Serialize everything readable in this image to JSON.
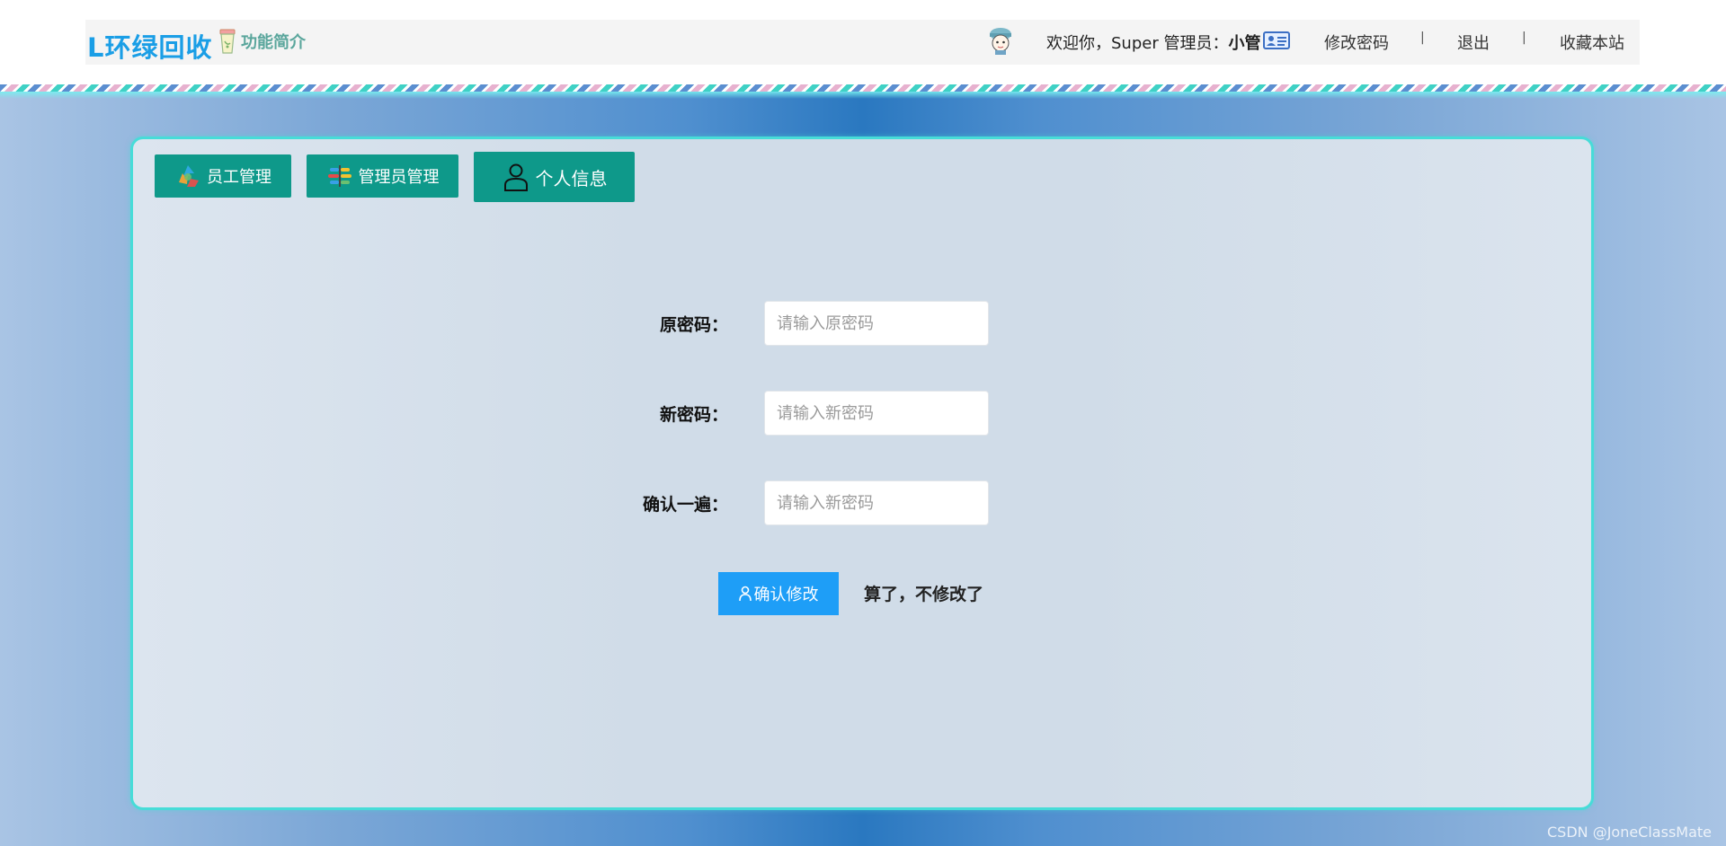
{
  "header": {
    "brand": "L环绿回收",
    "intro_link": "功能简介",
    "welcome_prefix": "欢迎你，Super 管理员：",
    "user_name": "小管",
    "change_password": "修改密码",
    "separator": "|",
    "logout": "退出",
    "bookmark": "收藏本站"
  },
  "tabs": [
    {
      "label": "员工管理",
      "icon": "recycle-icon"
    },
    {
      "label": "管理员管理",
      "icon": "sort-icon"
    },
    {
      "label": "个人信息",
      "icon": "user-icon"
    }
  ],
  "form": {
    "old_password": {
      "label": "原密码：",
      "placeholder": "请输入原密码",
      "value": ""
    },
    "new_password": {
      "label": "新密码：",
      "placeholder": "请输入新密码",
      "value": ""
    },
    "confirm_password": {
      "label": "确认一遍：",
      "placeholder": "请输入新密码",
      "value": ""
    },
    "confirm_button": "确认修改",
    "cancel_text": "算了，不修改了"
  },
  "watermark": "CSDN @JoneClassMate",
  "colors": {
    "brand": "#1a9ee6",
    "tab_bg": "#0e998a",
    "primary_button": "#1e9ef7",
    "panel_border": "#47dcd8"
  }
}
